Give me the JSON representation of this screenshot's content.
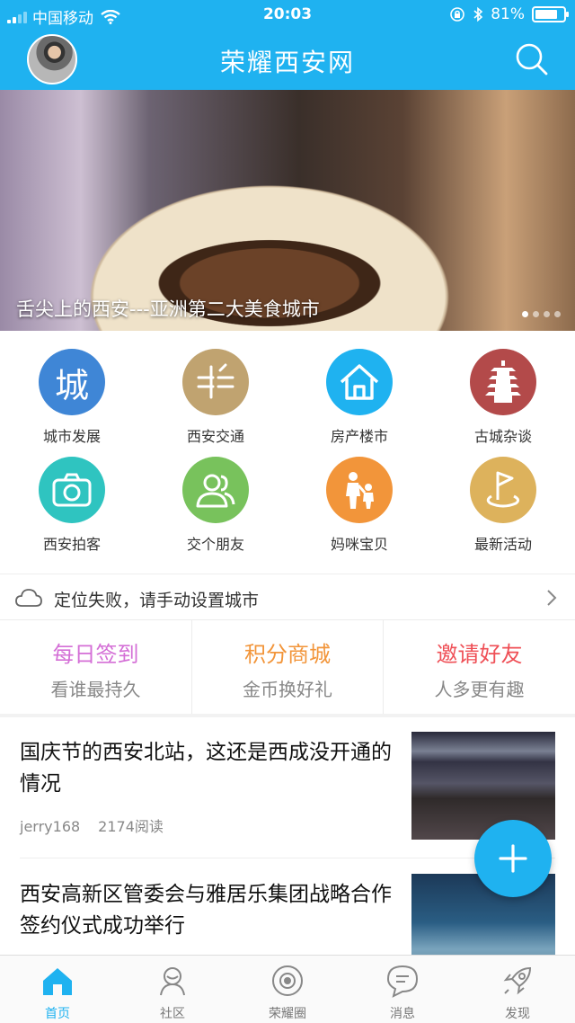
{
  "status_bar": {
    "carrier": "中国移动",
    "time": "20:03",
    "battery": "81%",
    "battery_level": 0.81
  },
  "header": {
    "title": "荣耀西安网"
  },
  "banner": {
    "caption": "舌尖上的西安---亚洲第二大美食城市",
    "slide_count": 4,
    "active_slide": 0
  },
  "grid": [
    {
      "label": "城市发展",
      "icon": "city-char-icon",
      "glyph": "城",
      "color": "#3f86d6"
    },
    {
      "label": "西安交通",
      "icon": "traffic-icon",
      "color": "#c0a370"
    },
    {
      "label": "房产楼市",
      "icon": "house-icon",
      "color": "#1fb2f0"
    },
    {
      "label": "古城杂谈",
      "icon": "pagoda-icon",
      "color": "#b34a4a"
    },
    {
      "label": "西安拍客",
      "icon": "camera-icon",
      "color": "#2fc4c0"
    },
    {
      "label": "交个朋友",
      "icon": "friends-icon",
      "color": "#78c25c"
    },
    {
      "label": "妈咪宝贝",
      "icon": "family-icon",
      "color": "#f2953a"
    },
    {
      "label": "最新活动",
      "icon": "flag-icon",
      "color": "#ddb25c"
    }
  ],
  "location": {
    "text": "定位失败，请手动设置城市"
  },
  "actions": [
    {
      "title": "每日签到",
      "subtitle": "看谁最持久",
      "color": "#d46fd6"
    },
    {
      "title": "积分商城",
      "subtitle": "金币换好礼",
      "color": "#f2953a"
    },
    {
      "title": "邀请好友",
      "subtitle": "人多更有趣",
      "color": "#ef4f56"
    }
  ],
  "articles": [
    {
      "title": "国庆节的西安北站，这还是西成没开通的情况",
      "author": "jerry168",
      "reads": "2174阅读"
    },
    {
      "title": "西安高新区管委会与雅居乐集团战略合作签约仪式成功举行"
    }
  ],
  "tabs": [
    {
      "label": "首页",
      "icon": "home-icon",
      "active": true
    },
    {
      "label": "社区",
      "icon": "community-icon"
    },
    {
      "label": "荣耀圈",
      "icon": "circle-icon"
    },
    {
      "label": "消息",
      "icon": "message-icon"
    },
    {
      "label": "发现",
      "icon": "rocket-icon"
    }
  ],
  "colors": {
    "primary": "#1fb2f0"
  }
}
